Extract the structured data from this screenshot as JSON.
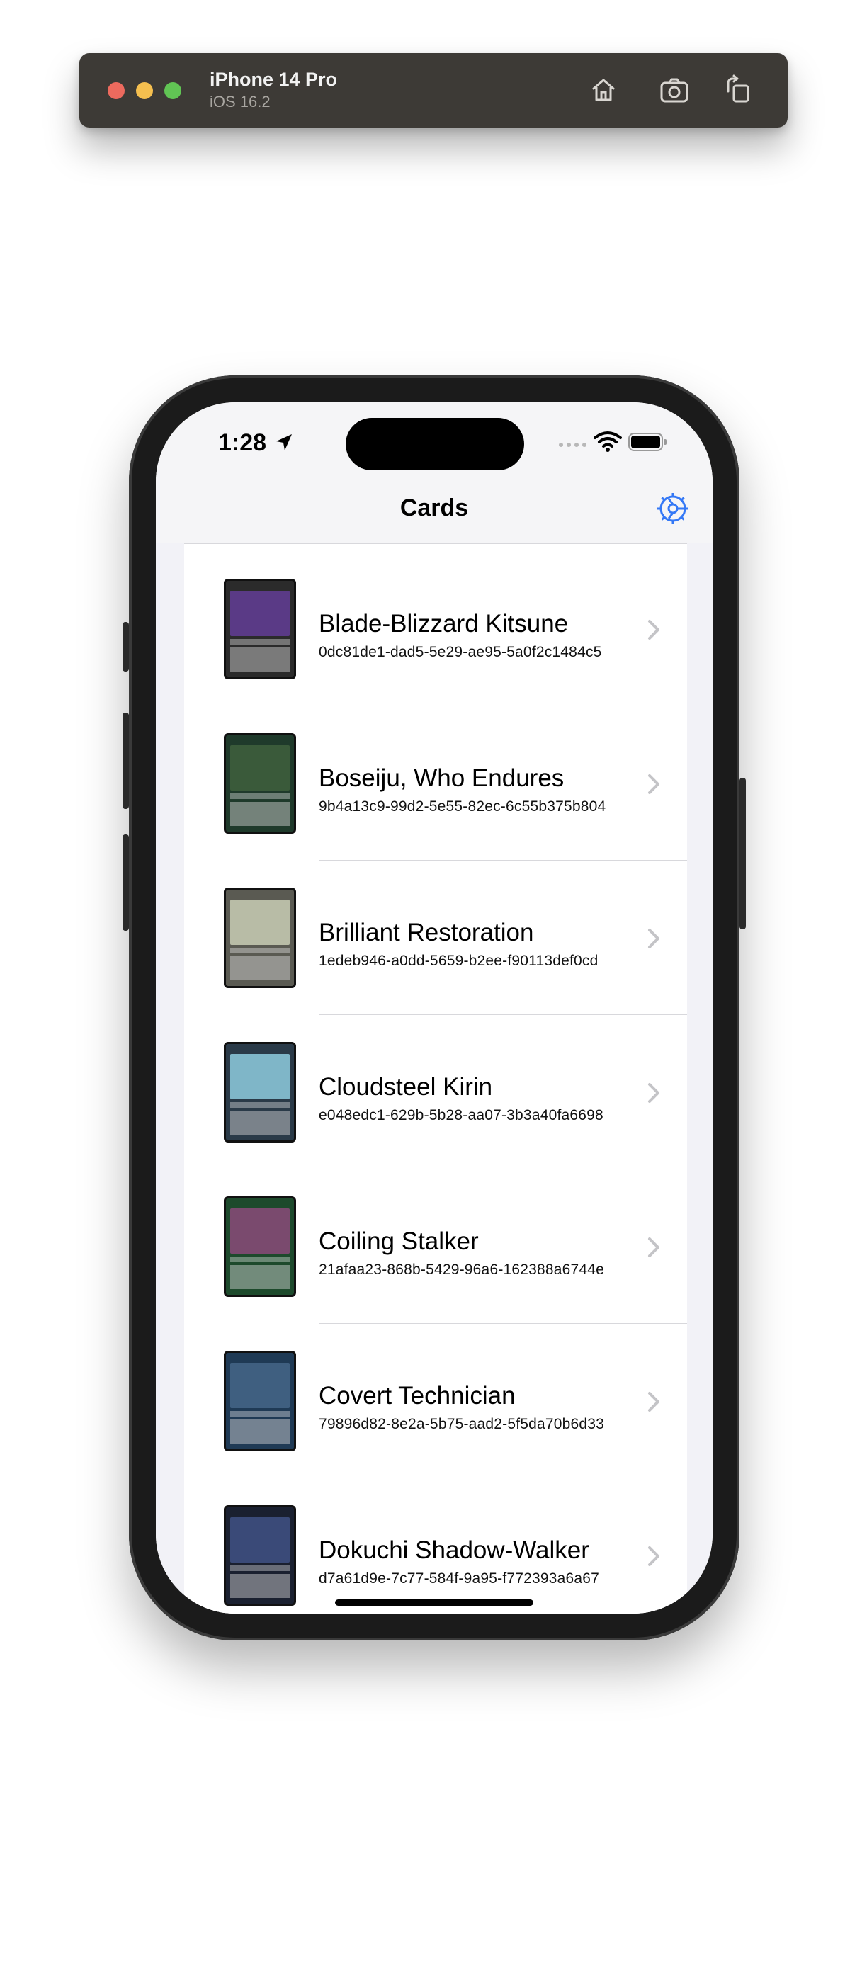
{
  "simulator": {
    "device_name": "iPhone 14 Pro",
    "os_version": "iOS 16.2",
    "buttons": [
      "home-icon",
      "screenshot-icon",
      "rotate-icon"
    ]
  },
  "status_bar": {
    "time": "1:28"
  },
  "navigation": {
    "title": "Cards",
    "settings_icon": "gear-icon",
    "accent_color": "#3478f6"
  },
  "cards": [
    {
      "name": "Blade-Blizzard Kitsune",
      "id": "0dc81de1-dad5-5e29-ae95-5a0f2c1484c5",
      "frame_color": "#2b2b2b",
      "art_color": "#5a3a86"
    },
    {
      "name": "Boseiju, Who Endures",
      "id": "9b4a13c9-99d2-5e55-82ec-6c55b375b804",
      "frame_color": "#1f3a2b",
      "art_color": "#3a5a3a"
    },
    {
      "name": "Brilliant Restoration",
      "id": "1edeb946-a0dd-5659-b2ee-f90113def0cd",
      "frame_color": "#5a5a52",
      "art_color": "#b8bca6"
    },
    {
      "name": "Cloudsteel Kirin",
      "id": "e048edc1-629b-5b28-aa07-3b3a40fa6698",
      "frame_color": "#2a3a48",
      "art_color": "#7fb6c8"
    },
    {
      "name": "Coiling Stalker",
      "id": "21afaa23-868b-5429-96a6-162388a6744e",
      "frame_color": "#1d4a2c",
      "art_color": "#7a4a6e"
    },
    {
      "name": "Covert Technician",
      "id": "79896d82-8e2a-5b75-aad2-5f5da70b6d33",
      "frame_color": "#1f3a55",
      "art_color": "#3f5f80"
    },
    {
      "name": "Dokuchi Shadow-Walker",
      "id": "d7a61d9e-7c77-584f-9a95-f772393a6a67",
      "frame_color": "#1a2030",
      "art_color": "#3a4a78"
    }
  ]
}
